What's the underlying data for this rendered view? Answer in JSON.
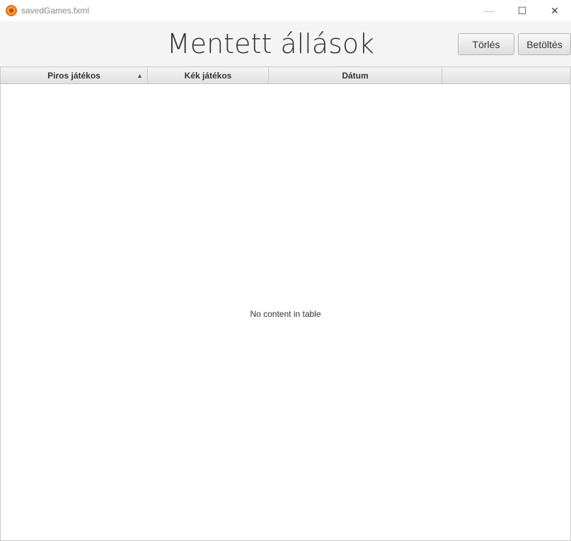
{
  "window": {
    "title": "savedGames.fxml",
    "minimize": "—",
    "maximize": "☐",
    "close": "✕"
  },
  "header": {
    "title": "Mentett állások",
    "delete_label": "Törlés",
    "load_label": "Betöltés"
  },
  "table": {
    "columns": [
      {
        "label": "Piros játékos",
        "sort": "▲"
      },
      {
        "label": "Kék játékos"
      },
      {
        "label": "Dátum"
      },
      {
        "label": ""
      }
    ],
    "placeholder": "No content in table",
    "rows": []
  }
}
